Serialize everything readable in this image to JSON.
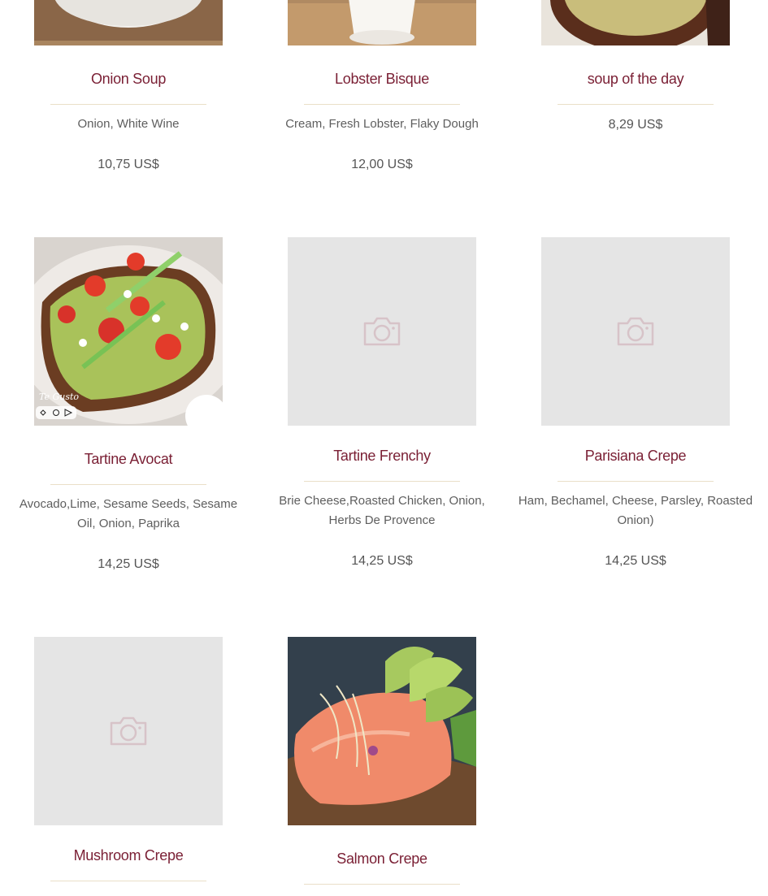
{
  "colors": {
    "title": "#7a1f34",
    "text": "#5e5e5e",
    "divider": "#eadfc8",
    "placeholder_bg": "#e5e5e5",
    "placeholder_icon": "#d7c3c8"
  },
  "items": [
    {
      "name": "Onion Soup",
      "description": "Onion, White Wine",
      "price": "10,75 US$",
      "image": "photo-soup-bowl"
    },
    {
      "name": "Lobster Bisque",
      "description": "Cream, Fresh Lobster, Flaky Dough",
      "price": "12,00 US$",
      "image": "photo-bisque-cup"
    },
    {
      "name": "soup of the day",
      "description": "",
      "price": "8,29 US$",
      "image": "photo-soup-of-day"
    },
    {
      "name": "Tartine Avocat",
      "description": "Avocado,Lime, Sesame Seeds, Sesame Oil, Onion, Paprika",
      "price": "14,25 US$",
      "image": "photo-avocado-tartine",
      "photo_overlay_text": "Te Gusto"
    },
    {
      "name": "Tartine Frenchy",
      "description": "Brie Cheese,Roasted Chicken, Onion, Herbs De Provence",
      "price": "14,25 US$",
      "image": "camera-icon"
    },
    {
      "name": "Parisiana Crepe",
      "description": "Ham, Bechamel, Cheese, Parsley, Roasted Onion)",
      "price": "14,25 US$",
      "image": "camera-icon"
    },
    {
      "name": "Mushroom Crepe",
      "description": "",
      "price": "",
      "image": "camera-icon"
    },
    {
      "name": "Salmon Crepe",
      "description": "",
      "price": "",
      "image": "photo-salmon-avocado"
    }
  ]
}
